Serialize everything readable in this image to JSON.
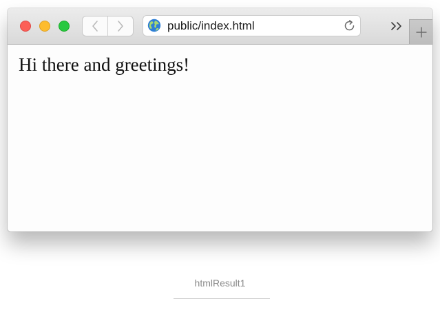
{
  "browser": {
    "traffic_lights": {
      "close_color": "#fc5f57",
      "minimize_color": "#fdbc2e",
      "maximize_color": "#28c840"
    },
    "navigation": {
      "back_icon": "chevron-left-icon",
      "forward_icon": "chevron-right-icon"
    },
    "address_bar": {
      "site_icon": "globe-icon",
      "url": "public/index.html",
      "reload_icon": "reload-icon"
    },
    "toolbar_extras": {
      "overflow_icon": "double-chevron-right-icon",
      "new_tab_icon": "plus-icon"
    }
  },
  "page": {
    "heading": "Hi there and greetings!"
  },
  "caption": {
    "text": "htmlResult1"
  }
}
